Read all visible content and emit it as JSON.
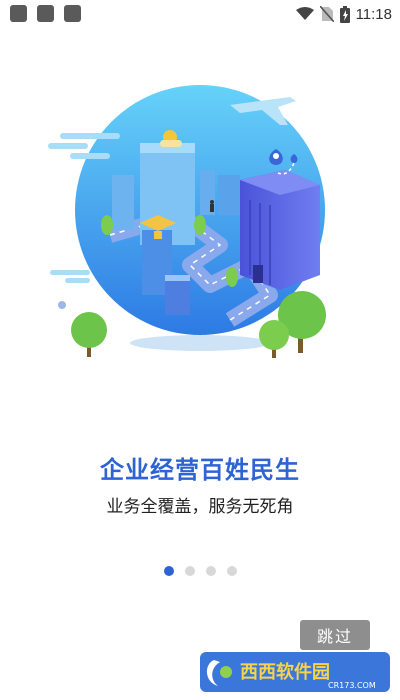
{
  "status_bar": {
    "time": "11:18",
    "icons": [
      "app-square-icon",
      "app-square-icon",
      "app-square-icon",
      "wifi-icon",
      "no-sim-icon",
      "battery-charging-icon"
    ]
  },
  "onboarding": {
    "title": "企业经营百姓民生",
    "subtitle": "业务全覆盖，服务无死角",
    "page_count": 4,
    "current_page": 1
  },
  "skip_button": {
    "label": "跳过"
  },
  "watermark": {
    "text": "西西软件园",
    "url_text": "CR173.COM"
  },
  "colors": {
    "accent": "#2d63d3",
    "dot_inactive": "#d8d8d8",
    "skip_bg": "#8e8e8e",
    "circle_top": "#5ec7f7",
    "circle_bottom": "#2f7ee6"
  }
}
